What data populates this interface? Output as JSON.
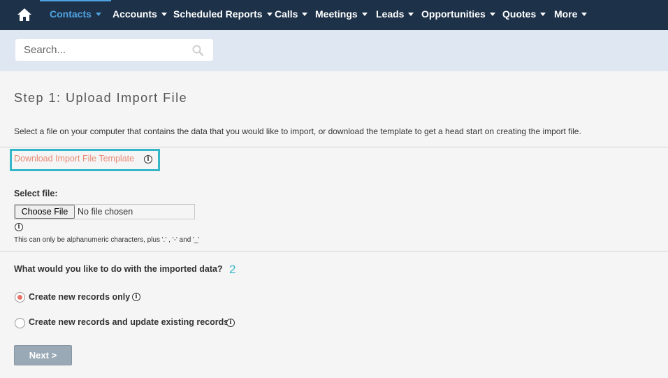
{
  "nav": {
    "home_icon": "home-icon",
    "items": [
      {
        "label": "Contacts",
        "active": true
      },
      {
        "label": "Accounts"
      },
      {
        "label": "Scheduled Reports"
      },
      {
        "label": "Calls"
      },
      {
        "label": "Meetings"
      },
      {
        "label": "Leads"
      },
      {
        "label": "Opportunities"
      },
      {
        "label": "Quotes"
      },
      {
        "label": "More"
      }
    ]
  },
  "search": {
    "placeholder": "Search...",
    "icon": "search-icon"
  },
  "step": {
    "title": "Step 1: Upload Import File",
    "intro": "Select a file on your computer that contains the data that you would like to import, or download the template to get a head start on creating the import file."
  },
  "template": {
    "link_label": "Download Import File Template",
    "annotation_color": "#36b7c9"
  },
  "file": {
    "label": "Select file:",
    "button_label": "Choose File",
    "status": "No file chosen",
    "note": "This can only be alphanumeric characters, plus '.' , '-' and '_'"
  },
  "import": {
    "question": "What would you like to do with the imported data?",
    "step_number": "2",
    "options": [
      {
        "label": "Create new records only",
        "selected": true
      },
      {
        "label": "Create new records and update existing records",
        "selected": false
      }
    ]
  },
  "actions": {
    "next_label": "Next >"
  },
  "colors": {
    "nav_bg": "#1d3149",
    "active": "#4fa3e0",
    "link": "#e88a74",
    "radio_selected": "#e8736a",
    "button": "#9aa9b6"
  }
}
